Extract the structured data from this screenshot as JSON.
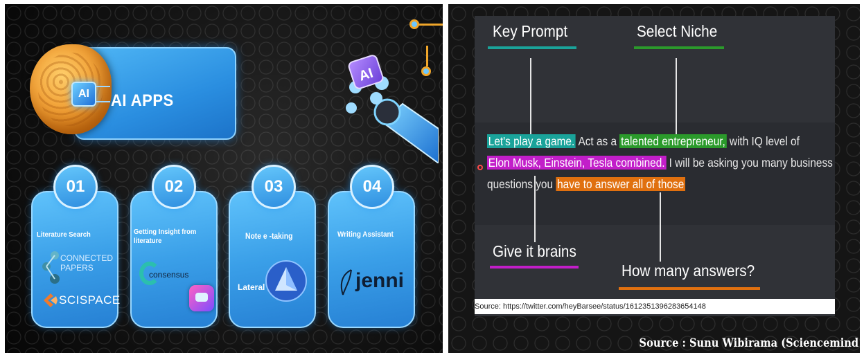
{
  "left": {
    "title": "AI APPS",
    "chip_label": "AI",
    "robot_chip_label": "AI",
    "cards": [
      {
        "number": "01",
        "title": "Literature Search",
        "logos": [
          "CONNECTED",
          "PAPERS",
          "SCISPACE"
        ]
      },
      {
        "number": "02",
        "title": "Getting Insight from literature",
        "logos": [
          "consensus"
        ]
      },
      {
        "number": "03",
        "title": "Note e  -taking",
        "logos": [
          "Lateral"
        ]
      },
      {
        "number": "04",
        "title": "Writing Assistant",
        "logos": [
          "jenni"
        ]
      }
    ]
  },
  "right": {
    "labels": {
      "key_prompt": "Key Prompt",
      "select_niche": "Select Niche",
      "give_brains": "Give it brains",
      "how_many": "How many answers?"
    },
    "prompt": {
      "line1_a": "Let's play a game.",
      "line1_b": " Act as a ",
      "line1_c": "talented entrepreneur,",
      "line1_d": " with IQ level of",
      "line2_a": "Elon Musk, Einstein, Tesla combined.",
      "line2_b": " I will be asking you many business",
      "line3_a": "questions you ",
      "line3_b": "have to answer all of those"
    },
    "source": "Source: https://twitter.com/heyBarsee/status/1612351396283654148",
    "credit": "Source : Sunu Wibirama (Sciencemind"
  },
  "colors": {
    "teal": "#1aa39a",
    "green": "#2b9a2b",
    "magenta": "#c21ec9",
    "orange": "#e0700f",
    "card_blue": "#3a9fe8"
  }
}
